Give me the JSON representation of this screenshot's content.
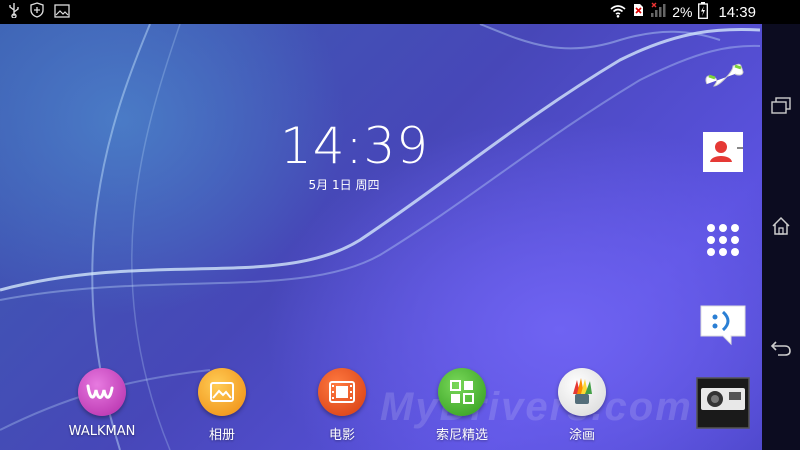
{
  "status_bar": {
    "left_icons": [
      "usb-icon",
      "shield-icon",
      "image-icon"
    ],
    "right_icons": [
      "wifi-icon",
      "no-sim-icon",
      "signal-icon",
      "battery-charging-icon"
    ],
    "battery": "2%",
    "time": "14:39"
  },
  "clock": {
    "time": "14:39",
    "date": "5月 1日 周四"
  },
  "dock_apps": [
    {
      "label": "WALKMAN",
      "icon": "walkman-icon",
      "color": "#c33ab8"
    },
    {
      "label": "相册",
      "icon": "album-icon",
      "color": "#f5a020"
    },
    {
      "label": "电影",
      "icon": "movies-icon",
      "color": "#e64a19"
    },
    {
      "label": "索尼精选",
      "icon": "sony-select-icon",
      "color": "#3fae2a"
    },
    {
      "label": "涂画",
      "icon": "sketch-icon",
      "color": "#f2f2f2"
    }
  ],
  "right_dock": [
    "phone-icon",
    "contacts-icon",
    "app-drawer-icon",
    "messaging-icon",
    "camera-icon"
  ],
  "nav_bar": [
    "recent-apps-icon",
    "home-icon",
    "back-icon"
  ],
  "watermark": "MyDrivers.com"
}
